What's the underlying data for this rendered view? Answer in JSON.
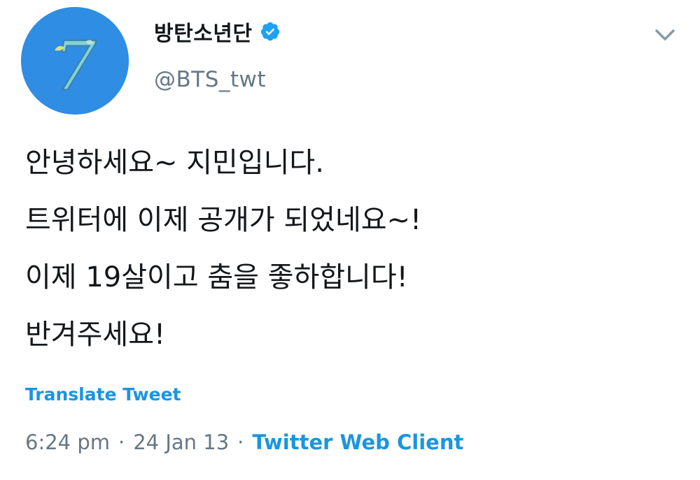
{
  "account": {
    "display_name": "방탄소년단",
    "handle": "@BTS_twt",
    "avatar_label": "7",
    "verified": true
  },
  "tweet": {
    "lines": [
      "안녕하세요~ 지민입니다.",
      "트위터에 이제 공개가 되었네요~!",
      "이제 19살이고 춤을 좋하합니다!",
      "반겨주세요!"
    ]
  },
  "translate": {
    "label": "Translate Tweet"
  },
  "meta": {
    "time": "6:24 pm",
    "separator": "·",
    "date": "24 Jan 13",
    "client": "Twitter Web Client"
  },
  "icons": {
    "verified": "verified-badge-icon",
    "caret": "chevron-down-icon"
  },
  "colors": {
    "accent": "#1b95e0",
    "secondary_text": "#657786",
    "primary_text": "#14171a",
    "avatar_bg": "#2f8de4"
  }
}
